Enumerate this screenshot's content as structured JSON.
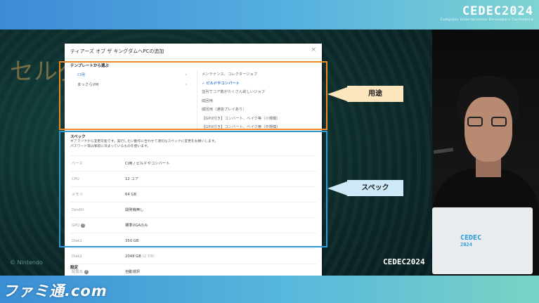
{
  "header": {
    "brand": "CEDEC2024",
    "brand_sub": "Computer Entertainment Developers Conference"
  },
  "footer": {
    "watermark": "ファミ通.com"
  },
  "slide": {
    "logo_text": "セルダ",
    "copyright": "© Nintendo",
    "slide_logo": "CEDEC2024",
    "labels": {
      "usage": "用途",
      "spec": "スペック"
    },
    "colors": {
      "usage_box": "#f08a2a",
      "spec_box": "#2f9ad6",
      "usage_tag": "#fde6bd",
      "spec_tag": "#cde9f7"
    }
  },
  "dialog": {
    "title": "ティアーズ オブ ザ キングダムへPCの追加",
    "close_icon": "close-icon",
    "template_section": "テンプレートから選ぶ",
    "template_categories": [
      {
        "label": "CI用",
        "active": true
      },
      {
        "label": "まっさらVM",
        "active": false
      }
    ],
    "template_options": [
      {
        "label": "メンテナンス、コレクタージョブ",
        "selected": false
      },
      {
        "label": "✓ ビルドやコンバート",
        "selected": true
      },
      {
        "label": "並列でコア数がたくさん欲しいジョブ",
        "selected": false
      },
      {
        "label": "縦回用",
        "selected": false
      },
      {
        "label": "縦回用（通信プレイあり）",
        "selected": false
      },
      {
        "label": "【GPU付き】コンバート、ベイク等（小規模）",
        "selected": false
      },
      {
        "label": "【GPU付き】コンバート、ベイク等（中規模）",
        "selected": false
      }
    ],
    "spec_section": "スペック",
    "spec_description_1": "ギアマークから変更可能です。実行したい動作に合わせて適切なスペックに変更をお願いします。",
    "spec_description_2": "パスワード等は事前に決まっているものを使います。",
    "spec_rows": [
      {
        "key": "ベース",
        "value": "CI用 / ビルドやコンバート",
        "muted": "",
        "help": false
      },
      {
        "key": "CPU",
        "value": "12 コア",
        "muted": "",
        "help": false
      },
      {
        "key": "メモリ",
        "value": "64 GB",
        "muted": "",
        "help": false
      },
      {
        "key": "DevKit",
        "value": "開発機無し",
        "muted": "",
        "help": false
      },
      {
        "key": "GPU",
        "value": "標準VGAのみ",
        "muted": "",
        "help": true
      },
      {
        "key": "Disk1",
        "value": "350 GB",
        "muted": "",
        "help": false
      },
      {
        "key": "Disk2",
        "value": "2048 GB",
        "muted": "(2 TiB)",
        "help": false
      },
      {
        "key": "配置先",
        "value": "自動選択",
        "muted": "",
        "help": true
      }
    ],
    "settings_section": "設定"
  },
  "speaker": {
    "laptop_logo_1": "CEDEC",
    "laptop_logo_2": "2024"
  }
}
